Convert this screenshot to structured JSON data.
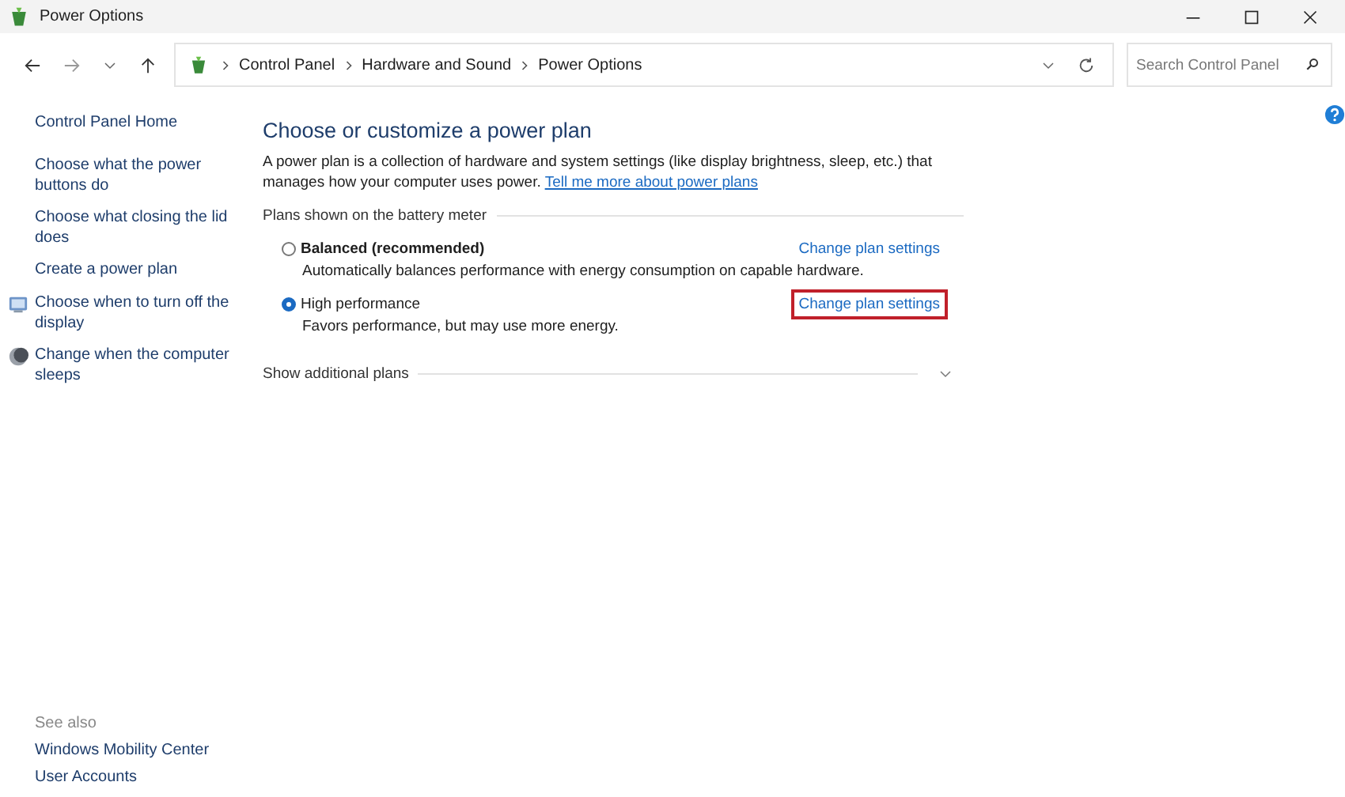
{
  "window": {
    "title": "Power Options"
  },
  "address_bar": {
    "breadcrumbs": [
      "Control Panel",
      "Hardware and Sound",
      "Power Options"
    ]
  },
  "search": {
    "placeholder": "Search Control Panel"
  },
  "sidebar": {
    "items": [
      {
        "label": "Control Panel Home",
        "kind": "home"
      },
      {
        "label": "Choose what the power buttons do",
        "kind": "plain"
      },
      {
        "label": "Choose what closing the lid does",
        "kind": "plain"
      },
      {
        "label": "Create a power plan",
        "kind": "plain"
      },
      {
        "label": "Choose when to turn off the display",
        "kind": "display"
      },
      {
        "label": "Change when the computer sleeps",
        "kind": "sleep"
      }
    ],
    "see_also": {
      "heading": "See also",
      "items": [
        "Windows Mobility Center",
        "User Accounts"
      ]
    }
  },
  "main": {
    "heading": "Choose or customize a power plan",
    "description": "A power plan is a collection of hardware and system settings (like display brightness, sleep, etc.) that manages how your computer uses power.",
    "learn_more_link": "Tell me more about power plans",
    "group_label": "Plans shown on the battery meter",
    "plans": [
      {
        "name": "Balanced (recommended)",
        "description": "Automatically balances performance with energy consumption on capable hardware.",
        "link": "Change plan settings",
        "selected": false,
        "highlighted": false
      },
      {
        "name": "High performance",
        "description": "Favors performance, but may use more energy.",
        "link": "Change plan settings",
        "selected": true,
        "highlighted": true
      }
    ],
    "additional_plans": {
      "label": "Show additional plans",
      "expanded": false
    }
  }
}
